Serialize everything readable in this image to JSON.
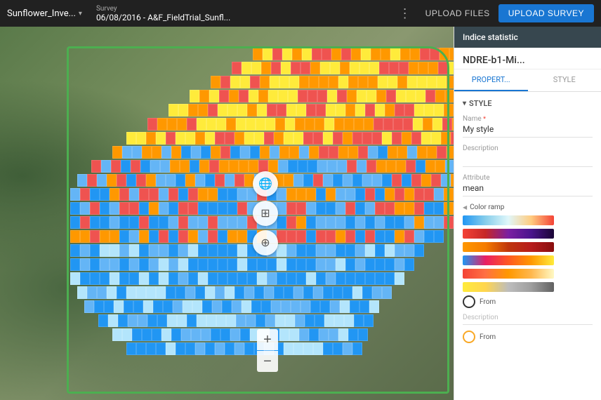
{
  "header": {
    "project_name": "Sunflower_Inve...",
    "survey_label": "Survey",
    "survey_name": "06/08/2016 - A&F_FieldTrial_Sunfl...",
    "more_icon": "⋮",
    "upload_files_label": "UPLOAD FILES",
    "upload_survey_label": "UPLOAD SURVEY"
  },
  "panel": {
    "header_label": "Indice statistic",
    "title": "NDRE-b1-Mi...",
    "tab_properties": "PROPERT...",
    "tab_style": "STYLE",
    "style_section": {
      "header": "STYLE",
      "name_label": "Name",
      "name_required": "*",
      "name_value": "My style",
      "description_label": "Description",
      "description_placeholder": "",
      "attribute_label": "Attribute",
      "attribute_value": "mean",
      "color_ramp_label": "Color ramp",
      "color_ramps": [
        {
          "id": "blue-orange",
          "colors": [
            "#2196f3",
            "#87ceeb",
            "#fff",
            "#ff9800",
            "#f44336"
          ]
        },
        {
          "id": "red-black",
          "colors": [
            "#f44336",
            "#c62828",
            "#7b1fa2",
            "#4a148c",
            "#1a0a2e"
          ]
        },
        {
          "id": "orange-red",
          "colors": [
            "#ff9800",
            "#f57c00",
            "#bf360c",
            "#b71c1c",
            "#880e0e"
          ]
        },
        {
          "id": "blue-red-yellow",
          "colors": [
            "#2196f3",
            "#e91e63",
            "#ff5722",
            "#ff9800",
            "#ffeb3b"
          ]
        },
        {
          "id": "red-yellow",
          "colors": [
            "#f44336",
            "#ff7043",
            "#ff9800",
            "#ffb74d",
            "#fff9c4"
          ]
        },
        {
          "id": "yellow-gray",
          "colors": [
            "#ffeb3b",
            "#ffd54f",
            "#bdbdbd",
            "#9e9e9e",
            "#616161"
          ]
        }
      ],
      "from_label": "From",
      "description2_label": "Description",
      "from2_label": "From"
    }
  },
  "map_controls": {
    "globe_icon": "🌐",
    "layers_icon": "⊞",
    "pin_icon": "📍",
    "zoom_in": "+",
    "zoom_out": "−"
  }
}
